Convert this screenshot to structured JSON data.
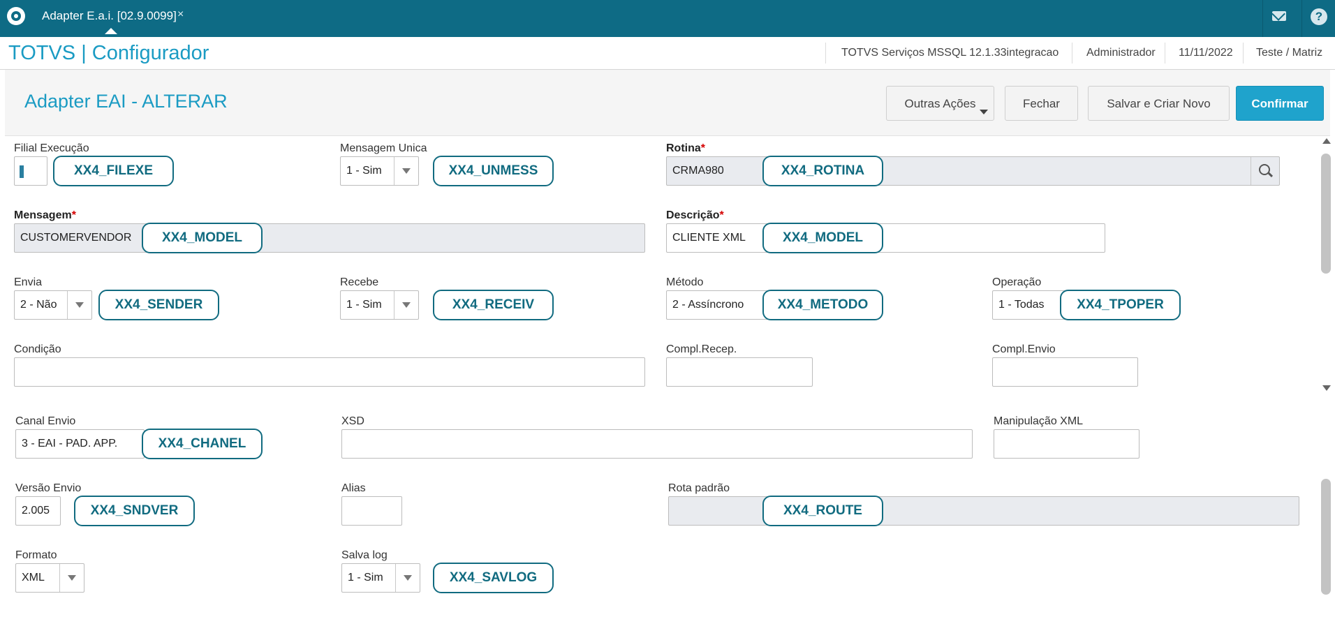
{
  "topbar": {
    "tab_label": "Adapter E.a.i. [02.9.0099]",
    "tab_close": "×",
    "help_glyph": "?"
  },
  "header": {
    "app_title": "TOTVS | Configurador",
    "environment": "TOTVS Serviços MSSQL 12.1.33integracao",
    "user": "Administrador",
    "date": "11/11/2022",
    "branch": "Teste / Matriz"
  },
  "page": {
    "title": "Adapter EAI - ALTERAR",
    "actions": {
      "outras": "Outras Ações",
      "fechar": "Fechar",
      "salvar_novo": "Salvar e Criar Novo",
      "confirmar": "Confirmar"
    }
  },
  "form": {
    "filial": {
      "label": "Filial Execução",
      "value": "",
      "tag": "XX4_FILEXE"
    },
    "unmess": {
      "label": "Mensagem Unica",
      "value": "1 - Sim",
      "tag": "XX4_UNMESS"
    },
    "rotina": {
      "label": "Rotina",
      "required": "*",
      "value": "CRMA980",
      "tag": "XX4_ROTINA"
    },
    "mensagem": {
      "label": "Mensagem",
      "required": "*",
      "value": "CUSTOMERVENDOR",
      "tag": "XX4_MODEL"
    },
    "descricao": {
      "label": "Descrição",
      "required": "*",
      "value": "CLIENTE XML",
      "tag": "XX4_MODEL"
    },
    "envia": {
      "label": "Envia",
      "value": "2 - Não",
      "tag": "XX4_SENDER"
    },
    "recebe": {
      "label": "Recebe",
      "value": "1 - Sim",
      "tag": "XX4_RECEIV"
    },
    "metodo": {
      "label": "Método",
      "value": "2 - Assíncrono",
      "tag": "XX4_METODO"
    },
    "operacao": {
      "label": "Operação",
      "value": "1 - Todas",
      "tag": "XX4_TPOPER"
    },
    "condicao": {
      "label": "Condição",
      "value": ""
    },
    "compl_recep": {
      "label": "Compl.Recep.",
      "value": ""
    },
    "compl_envio": {
      "label": "Compl.Envio",
      "value": ""
    },
    "canal": {
      "label": "Canal Envio",
      "value": "3 - EAI - PAD. APP.",
      "tag": "XX4_CHANEL"
    },
    "xsd": {
      "label": "XSD",
      "value": ""
    },
    "manip": {
      "label": "Manipulação XML",
      "value": ""
    },
    "versao": {
      "label": "Versão Envio",
      "value": "2.005",
      "tag": "XX4_SNDVER"
    },
    "alias": {
      "label": "Alias",
      "value": ""
    },
    "rota": {
      "label": "Rota padrão",
      "value": "",
      "tag": "XX4_ROUTE"
    },
    "formato": {
      "label": "Formato",
      "value": "XML"
    },
    "savlog": {
      "label": "Salva log",
      "value": "1 - Sim",
      "tag": "XX4_SAVLOG"
    }
  },
  "colors": {
    "topbar": "#0e6b85",
    "accent": "#1a9bc3",
    "primary_button": "#1fa3cc",
    "badge_border": "#116b80",
    "required": "#d40000",
    "readonly_field": "#e9ebef"
  },
  "icons": [
    "totvs-logo-icon",
    "close-icon",
    "mail-icon",
    "help-icon",
    "search-icon",
    "chevron-down-icon"
  ]
}
